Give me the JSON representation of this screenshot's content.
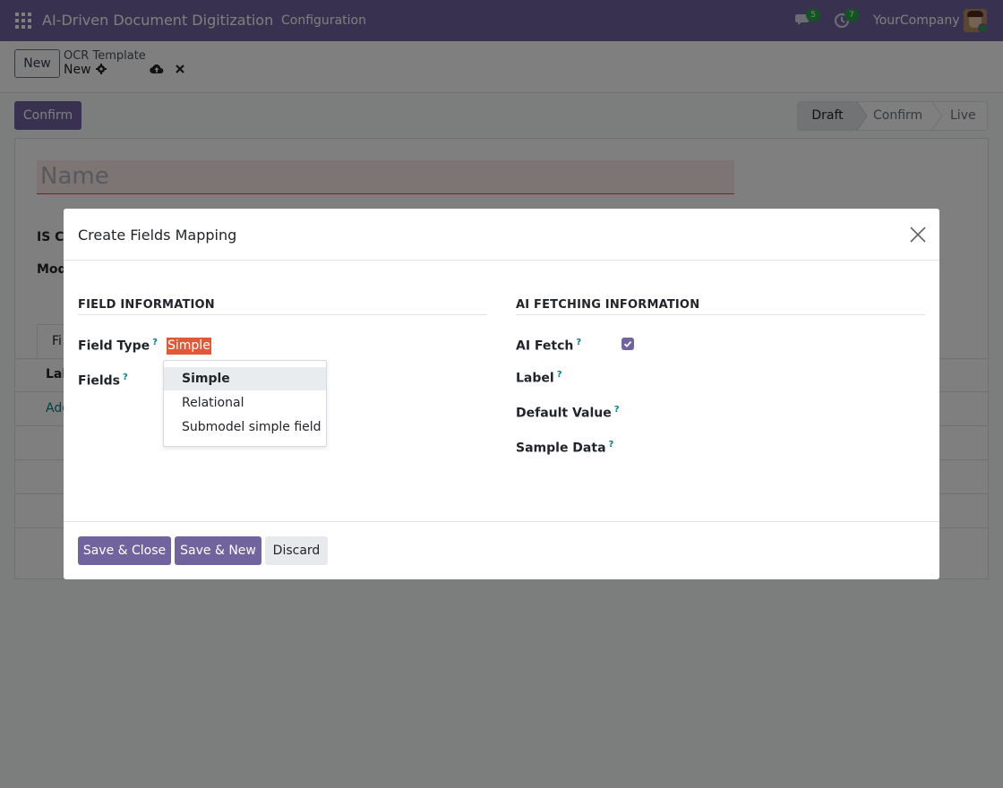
{
  "navbar": {
    "app_title": "AI-Driven Document Digitization",
    "menu_configuration": "Configuration",
    "chat_count": "5",
    "activity_count": "7",
    "company": "YourCompany"
  },
  "control_panel": {
    "new_label": "New",
    "breadcrumb_parent": "OCR Template",
    "breadcrumb_current": "New"
  },
  "form": {
    "confirm_label": "Confirm",
    "statusbar": [
      "Draft",
      "Confirm",
      "Live"
    ],
    "name_placeholder": "Name",
    "label_is": "IS Ch",
    "label_mod": "Mod",
    "tab_stub": "Fi",
    "table_head_stub": "Lab",
    "add_line_stub": "Add"
  },
  "modal": {
    "title": "Create Fields Mapping",
    "field_info_title": "FIELD INFORMATION",
    "ai_info_title": "AI FETCHING INFORMATION",
    "field_type_label": "Field Type",
    "field_type_value": "Simple",
    "fields_label": "Fields",
    "dropdown_options": [
      "Simple",
      "Relational",
      "Submodel simple field"
    ],
    "ai_fetch_label": "AI Fetch",
    "ai_fetch_checked": true,
    "label_label": "Label",
    "default_value_label": "Default Value",
    "sample_data_label": "Sample Data",
    "help_mark": "?",
    "save_close": "Save & Close",
    "save_new": "Save & New",
    "discard": "Discard"
  },
  "colors": {
    "navbar": "#71639e",
    "primary": "#71639e",
    "badge": "#28a745",
    "highlight": "#e05a3a"
  },
  "icons": [
    "apps-grid-icon",
    "chat-icon",
    "activity-clock-icon",
    "gear-icon",
    "cloud-upload-icon",
    "close-x-icon",
    "checkbox-checked-icon"
  ]
}
